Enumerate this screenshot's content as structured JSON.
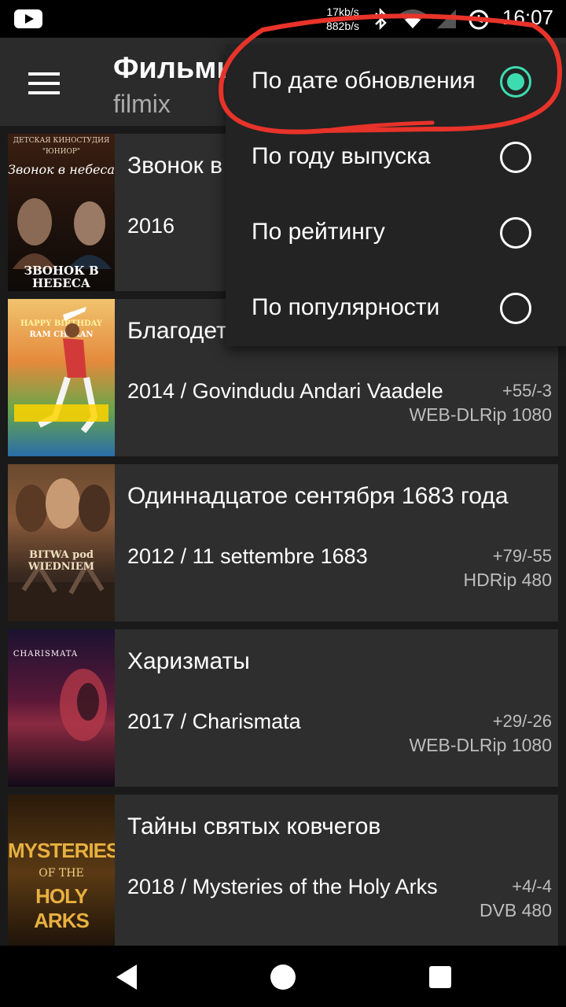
{
  "status_bar": {
    "net_speed_up": "17kb/s",
    "net_speed_down": "882b/s",
    "time": "16:07",
    "icons": [
      "youtube-icon",
      "bluetooth-icon",
      "wifi-icon",
      "signal-icon",
      "alarm-icon"
    ]
  },
  "app_bar": {
    "title": "Фильмы",
    "subtitle": "filmix"
  },
  "sort_menu": {
    "items": [
      {
        "label": "По дате обновления",
        "selected": true
      },
      {
        "label": "По году выпуска",
        "selected": false
      },
      {
        "label": "По рейтингу",
        "selected": false
      },
      {
        "label": "По популярности",
        "selected": false
      }
    ],
    "accent_color": "#3ddcb0",
    "annotation_color": "#e8332a"
  },
  "movies": [
    {
      "title": "Звонок в небеса",
      "year_line": "2016",
      "rating": "",
      "quality": "",
      "poster_top": "ДЕТСКАЯ КИНОСТУДИЯ",
      "poster_sub": "\"ЮНИОР\"",
      "poster_name": "Звонок в небеса",
      "poster_bottom": "ЗВОНОК В НЕБЕСА"
    },
    {
      "title": "Благодетель",
      "year_line": "2014 / Govindudu Andari Vaadele",
      "rating": "+55/-3",
      "quality": "WEB-DLRip 1080",
      "poster_top": "HAPPY BIRTHDAY",
      "poster_sub": "RAM CHARAN"
    },
    {
      "title": "Одиннадцатое сентября 1683 года",
      "year_line": "2012 / 11 settembre 1683",
      "rating": "+79/-55",
      "quality": "HDRip 480",
      "poster_name": "BITWA pod WIEDNIEM"
    },
    {
      "title": "Харизматы",
      "year_line": "2017 / Charismata",
      "rating": "+29/-26",
      "quality": "WEB-DLRip 1080",
      "poster_name": "CHARISMATA"
    },
    {
      "title": "Тайны святых ковчегов",
      "year_line": "2018 / Mysteries of the Holy Arks",
      "rating": "+4/-4",
      "quality": "DVB 480",
      "poster_top": "MYSTERIES",
      "poster_sub": "OF THE",
      "poster_name": "HOLY ARKS"
    }
  ]
}
